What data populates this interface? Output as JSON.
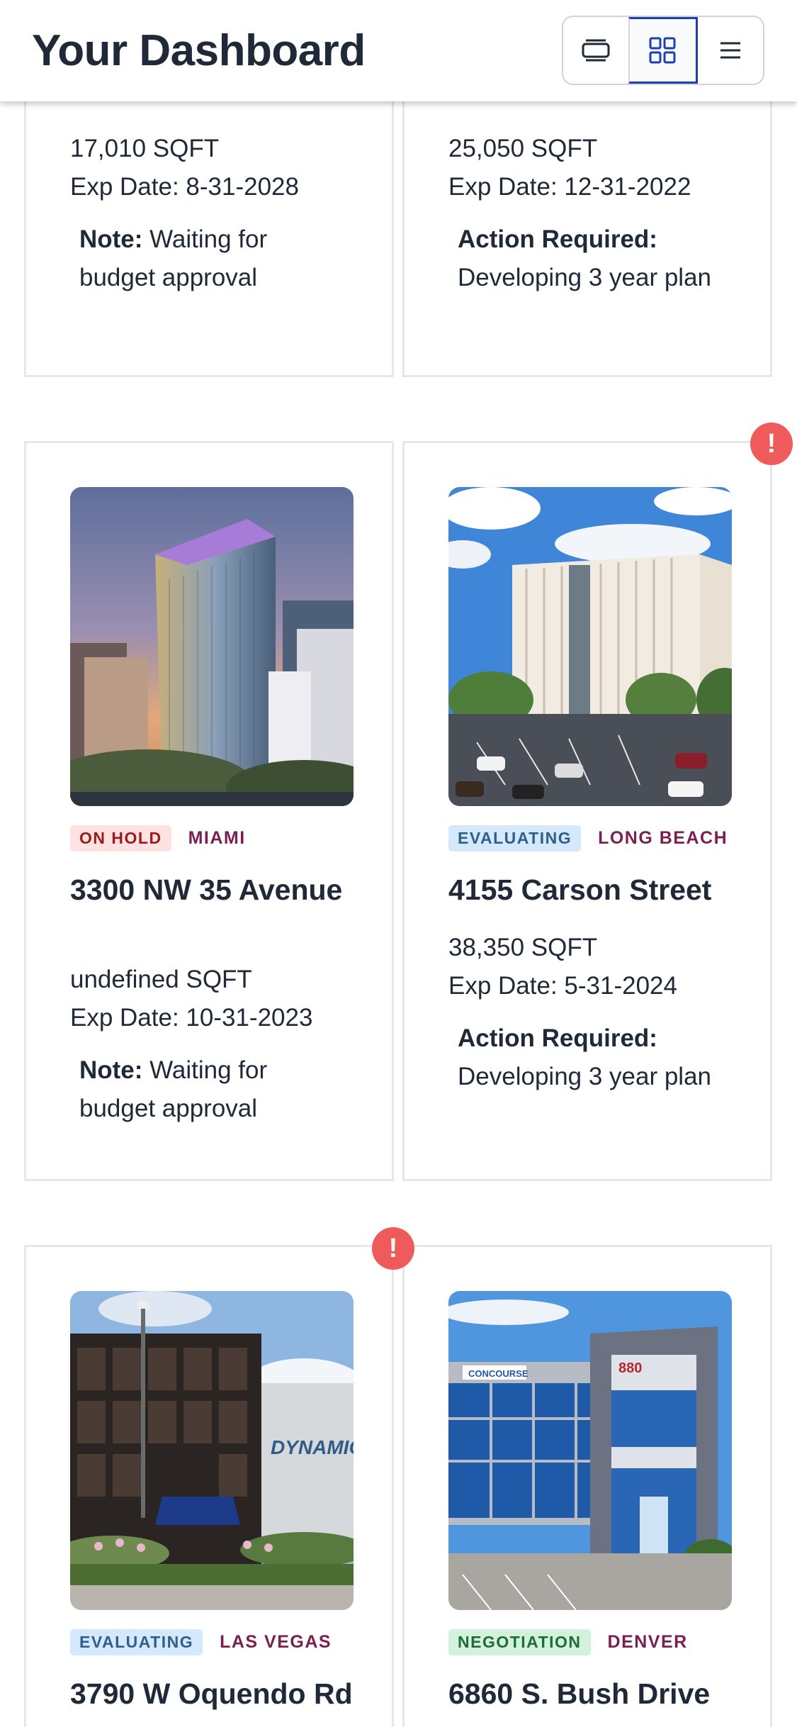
{
  "header": {
    "title": "Your Dashboard",
    "view_buttons": [
      {
        "name": "card-view",
        "icon": "single-card-icon",
        "active": false
      },
      {
        "name": "grid-view",
        "icon": "grid-icon",
        "active": true
      },
      {
        "name": "list-view",
        "icon": "hamburger-menu-icon",
        "active": false
      }
    ]
  },
  "colors": {
    "on_hold_bg": "#fde2e2",
    "on_hold_fg": "#9b1c1c",
    "evaluating_bg": "#d4e9fb",
    "evaluating_fg": "#2f5f8a",
    "negotiation_bg": "#d3f2dc",
    "negotiation_fg": "#1f6b3a",
    "city": "#7a1f52",
    "alert": "#ef5b5b",
    "active_border": "#1e40af"
  },
  "top_cards": [
    {
      "sqft": "17,010 SQFT",
      "exp": "Exp Date: 8-31-2028",
      "note_label": "Note:",
      "note_text": "Waiting for budget approval"
    },
    {
      "sqft": "25,050 SQFT",
      "exp": "Exp Date: 12-31-2022",
      "note_label": "Action Required:",
      "note_text": "Developing 3 year plan"
    }
  ],
  "middle_cards": [
    {
      "status": "ON HOLD",
      "city": "MIAMI",
      "address": "3300 NW 35 Avenue",
      "sqft": "undefined SQFT",
      "exp": "Exp Date: 10-31-2023",
      "note_label": "Note:",
      "note_text": "Waiting for budget approval"
    },
    {
      "status": "EVALUATING",
      "city": "LONG BEACH",
      "address": "4155 Carson Street",
      "sqft": "38,350 SQFT",
      "exp": "Exp Date: 5-31-2024",
      "note_label": "Action Required:",
      "note_text": "Developing 3 year plan"
    }
  ],
  "bottom_cards": [
    {
      "status": "EVALUATING",
      "city": "LAS VEGAS",
      "address": "3790 W Oquendo Rd"
    },
    {
      "status": "NEGOTIATION",
      "city": "DENVER",
      "address": "6860 S. Bush Drive"
    }
  ],
  "photo_signs": {
    "dynamic": "DYNAMIC",
    "concourse": "CONCOURSE",
    "number": "880"
  },
  "alert_glyph": "!"
}
